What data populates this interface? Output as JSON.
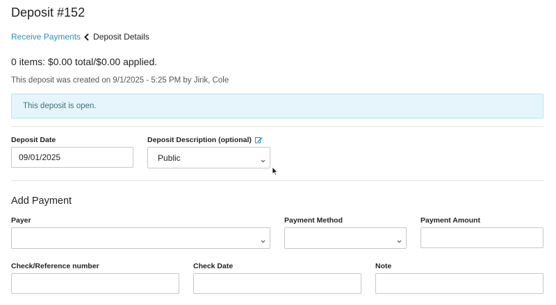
{
  "page": {
    "title": "Deposit #152"
  },
  "breadcrumb": {
    "parent": "Receive Payments",
    "current": "Deposit Details"
  },
  "summary": {
    "items_text": "0 items: $0.00 total/$0.00 applied.",
    "created_text": "This deposit was created on 9/1/2025 - 5:25 PM by Jirik, Cole"
  },
  "alert": {
    "text": "This deposit is open."
  },
  "deposit_form": {
    "date_label": "Deposit Date",
    "date_value": "09/01/2025",
    "description_label": "Deposit Description (optional)",
    "description_value": "Public"
  },
  "add_payment": {
    "title": "Add Payment",
    "payer_label": "Payer",
    "payer_value": "",
    "method_label": "Payment Method",
    "method_value": "",
    "amount_label": "Payment Amount",
    "amount_value": "",
    "reference_label": "Check/Reference number",
    "reference_value": "",
    "check_date_label": "Check Date",
    "check_date_value": "",
    "note_label": "Note",
    "note_value": ""
  },
  "colors": {
    "link": "#2a8fb5",
    "alert_bg": "#e6f5fb",
    "alert_border": "#b9e2ef",
    "alert_text": "#3d6f80"
  }
}
